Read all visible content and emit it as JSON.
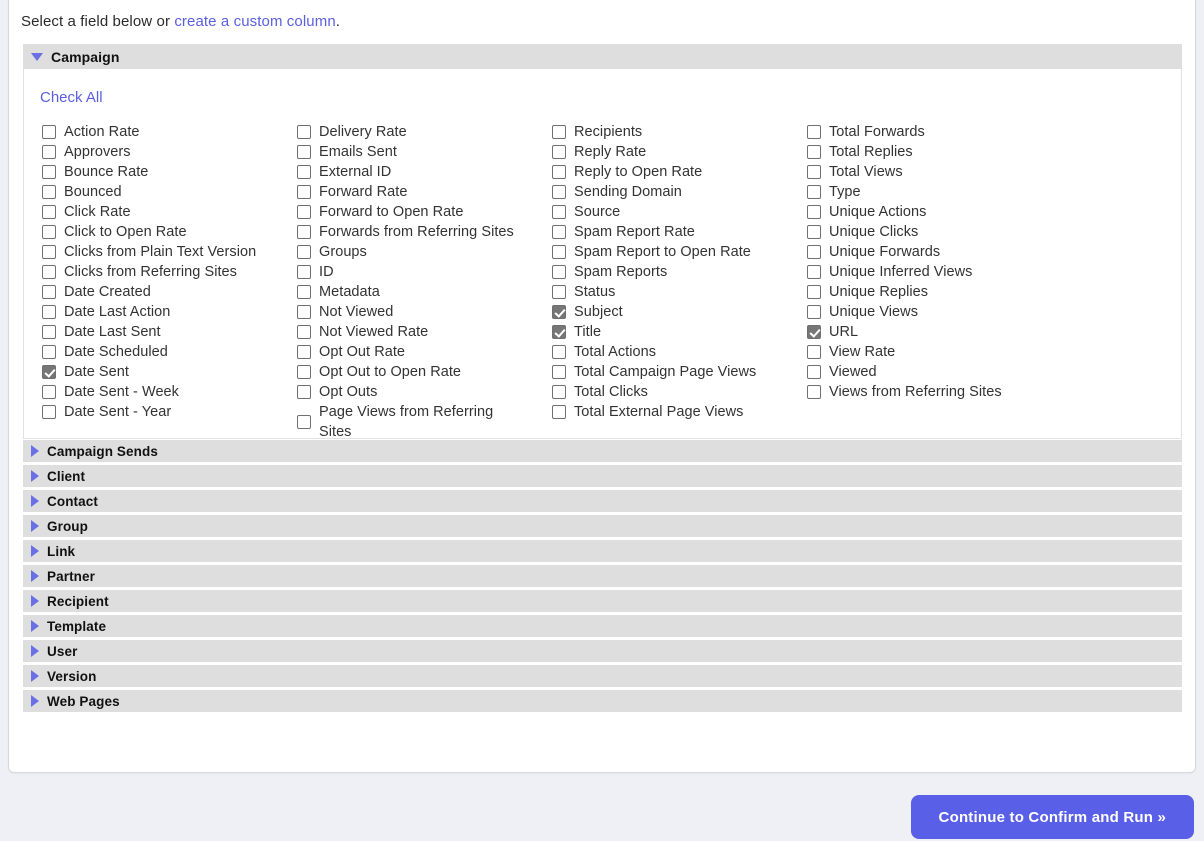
{
  "intro": {
    "prefix": "Select a field below or ",
    "link": "create a custom column",
    "suffix": "."
  },
  "expanded_section": {
    "title": "Campaign",
    "toggle_icon": "triangle-down-icon",
    "check_all_label": "Check All",
    "columns": [
      {
        "options": [
          {
            "label": "Action Rate",
            "checked": false
          },
          {
            "label": "Approvers",
            "checked": false
          },
          {
            "label": "Bounce Rate",
            "checked": false
          },
          {
            "label": "Bounced",
            "checked": false
          },
          {
            "label": "Click Rate",
            "checked": false
          },
          {
            "label": "Click to Open Rate",
            "checked": false
          },
          {
            "label": "Clicks from Plain Text Version",
            "checked": false
          },
          {
            "label": "Clicks from Referring Sites",
            "checked": false
          },
          {
            "label": "Date Created",
            "checked": false
          },
          {
            "label": "Date Last Action",
            "checked": false
          },
          {
            "label": "Date Last Sent",
            "checked": false
          },
          {
            "label": "Date Scheduled",
            "checked": false
          },
          {
            "label": "Date Sent",
            "checked": true
          },
          {
            "label": "Date Sent - Week",
            "checked": false
          },
          {
            "label": "Date Sent - Year",
            "checked": false
          }
        ]
      },
      {
        "options": [
          {
            "label": "Delivery Rate",
            "checked": false
          },
          {
            "label": "Emails Sent",
            "checked": false
          },
          {
            "label": "External ID",
            "checked": false
          },
          {
            "label": "Forward Rate",
            "checked": false
          },
          {
            "label": "Forward to Open Rate",
            "checked": false
          },
          {
            "label": "Forwards from Referring Sites",
            "checked": false
          },
          {
            "label": "Groups",
            "checked": false
          },
          {
            "label": "ID",
            "checked": false
          },
          {
            "label": "Metadata",
            "checked": false
          },
          {
            "label": "Not Viewed",
            "checked": false
          },
          {
            "label": "Not Viewed Rate",
            "checked": false
          },
          {
            "label": "Opt Out Rate",
            "checked": false
          },
          {
            "label": "Opt Out to Open Rate",
            "checked": false
          },
          {
            "label": "Opt Outs",
            "checked": false
          },
          {
            "label": "Page Views from Referring Sites",
            "checked": false
          }
        ]
      },
      {
        "options": [
          {
            "label": "Recipients",
            "checked": false
          },
          {
            "label": "Reply Rate",
            "checked": false
          },
          {
            "label": "Reply to Open Rate",
            "checked": false
          },
          {
            "label": "Sending Domain",
            "checked": false
          },
          {
            "label": "Source",
            "checked": false
          },
          {
            "label": "Spam Report Rate",
            "checked": false
          },
          {
            "label": "Spam Report to Open Rate",
            "checked": false
          },
          {
            "label": "Spam Reports",
            "checked": false
          },
          {
            "label": "Status",
            "checked": false
          },
          {
            "label": "Subject",
            "checked": true
          },
          {
            "label": "Title",
            "checked": true
          },
          {
            "label": "Total Actions",
            "checked": false
          },
          {
            "label": "Total Campaign Page Views",
            "checked": false
          },
          {
            "label": "Total Clicks",
            "checked": false
          },
          {
            "label": "Total External Page Views",
            "checked": false
          }
        ]
      },
      {
        "options": [
          {
            "label": "Total Forwards",
            "checked": false
          },
          {
            "label": "Total Replies",
            "checked": false
          },
          {
            "label": "Total Views",
            "checked": false
          },
          {
            "label": "Type",
            "checked": false
          },
          {
            "label": "Unique Actions",
            "checked": false
          },
          {
            "label": "Unique Clicks",
            "checked": false
          },
          {
            "label": "Unique Forwards",
            "checked": false
          },
          {
            "label": "Unique Inferred Views",
            "checked": false
          },
          {
            "label": "Unique Replies",
            "checked": false
          },
          {
            "label": "Unique Views",
            "checked": false
          },
          {
            "label": "URL",
            "checked": true
          },
          {
            "label": "View Rate",
            "checked": false
          },
          {
            "label": "Viewed",
            "checked": false
          },
          {
            "label": "Views from Referring Sites",
            "checked": false
          }
        ]
      }
    ]
  },
  "collapsed_sections": [
    {
      "title": "Campaign Sends",
      "toggle_icon": "triangle-right-icon"
    },
    {
      "title": "Client",
      "toggle_icon": "triangle-right-icon"
    },
    {
      "title": "Contact",
      "toggle_icon": "triangle-right-icon"
    },
    {
      "title": "Group",
      "toggle_icon": "triangle-right-icon"
    },
    {
      "title": "Link",
      "toggle_icon": "triangle-right-icon"
    },
    {
      "title": "Partner",
      "toggle_icon": "triangle-right-icon"
    },
    {
      "title": "Recipient",
      "toggle_icon": "triangle-right-icon"
    },
    {
      "title": "Template",
      "toggle_icon": "triangle-right-icon"
    },
    {
      "title": "User",
      "toggle_icon": "triangle-right-icon"
    },
    {
      "title": "Version",
      "toggle_icon": "triangle-right-icon"
    },
    {
      "title": "Web Pages",
      "toggle_icon": "triangle-right-icon"
    }
  ],
  "footer": {
    "continue_label": "Continue to Confirm and Run »"
  },
  "colors": {
    "accent": "#5a5fe8",
    "link": "#5a5fe0",
    "bar_bg": "#dedede",
    "page_bg": "#eff0f5",
    "checked_box": "#767676"
  }
}
